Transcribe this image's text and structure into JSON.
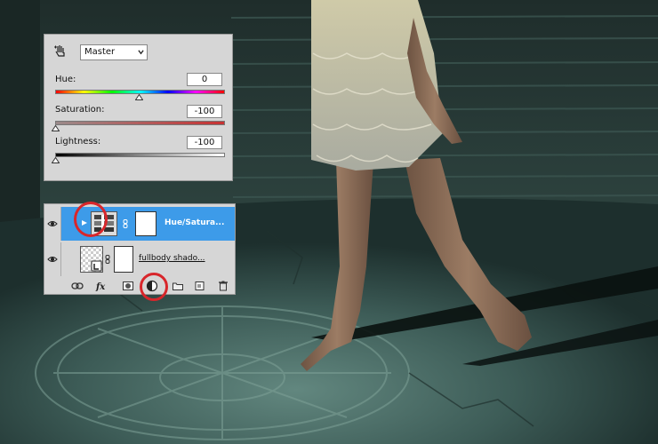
{
  "adjustment_panel": {
    "preset": "Master",
    "hue": {
      "label": "Hue:",
      "value": "0"
    },
    "saturation": {
      "label": "Saturation:",
      "value": "-100"
    },
    "lightness": {
      "label": "Lightness:",
      "value": "-100"
    },
    "icons": [
      "targeted-adjustment-hand-icon",
      "chevron-down-icon"
    ]
  },
  "layers_panel": {
    "layers": [
      {
        "name": "Hue/Satura...",
        "selected": true
      },
      {
        "name": "fullbody shado...",
        "selected": false
      }
    ],
    "footer_icons": [
      "link-icon",
      "fx-icon",
      "mask-icon",
      "adjustment-layer-icon",
      "folder-icon",
      "new-layer-icon",
      "trash-icon"
    ]
  },
  "colors": {
    "selection": "#3d9be9",
    "annotation": "#d8262b",
    "panel": "#d6d6d6"
  }
}
